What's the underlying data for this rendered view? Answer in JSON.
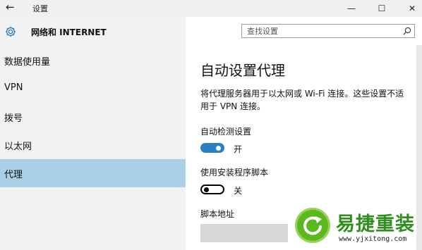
{
  "window": {
    "back_glyph": "←",
    "title": "设置",
    "minimize_glyph": "—",
    "maximize_glyph": "☐",
    "close_glyph": "✕"
  },
  "sidebar": {
    "section_title": "网络和 INTERNET",
    "items": [
      {
        "label": "数据使用量"
      },
      {
        "label": "VPN"
      },
      {
        "label": "拨号"
      },
      {
        "label": "以太网"
      },
      {
        "label": "代理",
        "selected": true
      }
    ]
  },
  "search": {
    "placeholder": "查找设置",
    "value": ""
  },
  "main": {
    "title": "自动设置代理",
    "description": "将代理服务器用于以太网或 Wi-Fi 连接。这些设置不适用于 VPN 连接。",
    "auto_detect": {
      "label": "自动检测设置",
      "state": "开",
      "on": true
    },
    "use_script": {
      "label": "使用安装程序脚本",
      "state": "关",
      "on": false
    },
    "script_address": {
      "label": "脚本地址",
      "value": ""
    }
  },
  "watermark": {
    "text": "易捷重装",
    "url": "www.yjxitong.com"
  },
  "colors": {
    "accent": "#2a7fc2",
    "selected_nav": "#a8d0e6",
    "sidebar_bg": "#f2f2f2",
    "logo_green": "#5cb81e"
  },
  "icons": {
    "settings": "gear-icon",
    "search": "search-icon",
    "back": "back-arrow-icon",
    "logo": "refresh-arrow-icon"
  }
}
